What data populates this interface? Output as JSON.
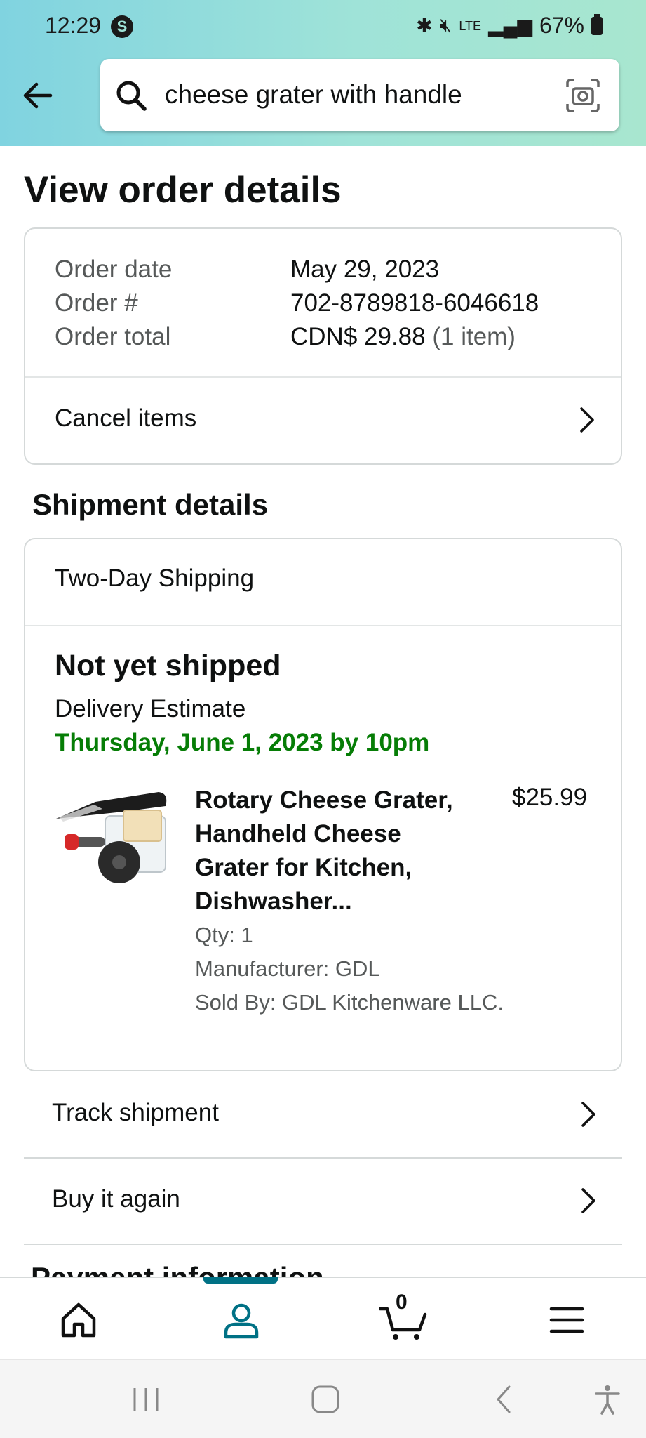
{
  "status_bar": {
    "time": "12:29",
    "app_badge": "S",
    "battery": "67%"
  },
  "search": {
    "query": "cheese grater with handle"
  },
  "page": {
    "title": "View order details"
  },
  "order": {
    "date_label": "Order date",
    "date_value": "May 29, 2023",
    "number_label": "Order #",
    "number_value": "702-8789818-6046618",
    "total_label": "Order total",
    "total_value": "CDN$ 29.88",
    "total_items": "(1 item)",
    "cancel_label": "Cancel items"
  },
  "shipment": {
    "section_title": "Shipment details",
    "speed": "Two-Day Shipping",
    "status": "Not yet shipped",
    "estimate_label": "Delivery Estimate",
    "estimate_date": "Thursday, June 1, 2023 by 10pm",
    "delivery_color": "#067d06",
    "item": {
      "title_line1": "Rotary Cheese Grater,",
      "title_line2": "Handheld Cheese",
      "title_line3": "Grater for Kitchen,",
      "title_line4": "Dishwasher...",
      "price": "$25.99",
      "qty": "Qty: 1",
      "manufacturer": "Manufacturer: GDL",
      "sold_by": "Sold By: GDL Kitchenware LLC."
    }
  },
  "actions": {
    "track": "Track shipment",
    "buy_again": "Buy it again"
  },
  "partial_section_title": "Payment information",
  "bottom_nav": {
    "cart_count": "0",
    "accent_color": "#007185"
  }
}
